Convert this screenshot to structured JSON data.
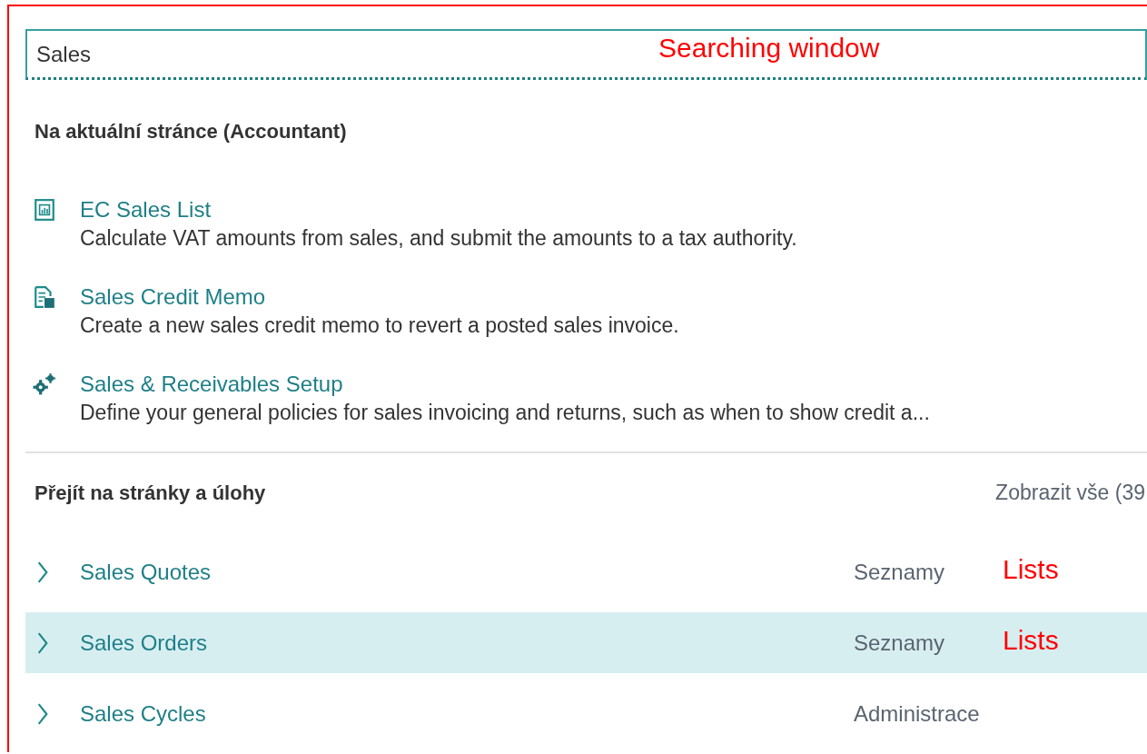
{
  "search": {
    "value": "Sales",
    "annotation": "Searching window"
  },
  "current_page": {
    "title": "Na aktuální stránce (Accountant)",
    "items": [
      {
        "kind": "report",
        "title": "EC Sales List",
        "description": "Calculate VAT amounts from sales, and submit the amounts to a tax authority."
      },
      {
        "kind": "document",
        "title": "Sales Credit Memo",
        "description": "Create a new sales credit memo to revert a posted sales invoice."
      },
      {
        "kind": "setup",
        "title": "Sales & Receivables Setup",
        "description": "Define your general policies for sales invoicing and returns, such as when to show credit a..."
      }
    ]
  },
  "pages_and_tasks": {
    "title": "Přejít na stránky a úlohy",
    "show_all": "Zobrazit vše (39",
    "rows": [
      {
        "title": "Sales Quotes",
        "category": "Seznamy",
        "annotation": "Lists",
        "selected": false
      },
      {
        "title": "Sales Orders",
        "category": "Seznamy",
        "annotation": "Lists",
        "selected": true
      },
      {
        "title": "Sales Cycles",
        "category": "Administrace",
        "selected": false
      }
    ]
  }
}
